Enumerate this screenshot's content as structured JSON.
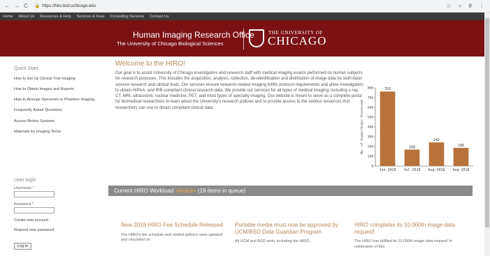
{
  "browser": {
    "back": "←",
    "forward": "→",
    "reload": "C",
    "url": "https://hiro.bsd.uchicago.edu",
    "star": "☆",
    "menu": "⋮",
    "ext": "○",
    "account": "θ"
  },
  "topnav": [
    "Home",
    "About Us",
    "Resources & Help",
    "Services & Fees",
    "Consulting Services",
    "Contact Us"
  ],
  "banner": {
    "title": "Human Imaging Research Office",
    "subtitle": "The University of Chicago Biological Sciences",
    "univ_top": "THE UNIVERSITY OF",
    "univ_bottom": "CHICAGO"
  },
  "sidebar": {
    "heading": "Quick Start",
    "links": [
      "How to Set Up Clinical Trial Imaging",
      "How to Obtain Images and Reports",
      "How to Arrange Specimen or Phantom Imaging",
      "Frequently Asked Questions",
      "Access Broker Systems",
      "Materials for Imaging Techs"
    ]
  },
  "login": {
    "heading": "User login",
    "username_label": "Username *",
    "password_label": "Password *",
    "create": "Create new account",
    "request": "Request new password",
    "button": "Log in"
  },
  "main": {
    "welcome": "Welcome to the HIRO!",
    "intro": "Our goal is to assist University of Chicago investigators and research staff with medical imaging exams performed on human subjects for research purposes. This includes the acquisition, analysis, collection, de-identification and distribution of image data for both basic science research and clinical trials. Our services ensure research-related imaging fulfills protocol requirements and allow investigators to obtain HIPAA- and IRB-compliant clinical research data. We provide our services for all types of medical imaging, including x-ray, CT, MRI, ultrasound, nuclear medicine, PET, and most types of specialty imaging. Our website is meant to serve as a complete portal for biomedical researchers to learn about the University's research policies and to provide access to the various resources that researchers can use to obtain compliant clinical data."
  },
  "workload": {
    "prefix": "Current HIRO Workload:",
    "level": "Medium",
    "suffix": "(19 items in queue)"
  },
  "news": [
    {
      "title": "New 2018 HIRO Fee Schedule Released",
      "body": "The HIRO's fee schedule and related policies were updated and circulated on"
    },
    {
      "title": "Portable media must now be approved by UCM/BSD Data Guardian Program",
      "body": "All UCM and BSD units, including the HIRO,"
    },
    {
      "title": "HIRO completes its 10,000th image data request!",
      "body": "The HIRO has fulfilled its 10,000th image data request! In celebration of this"
    }
  ],
  "chart_data": {
    "type": "bar",
    "categories": [
      "Jun-2018",
      "Jul-2018",
      "Aug-2018",
      "Sep-2018"
    ],
    "values": [
      763,
      168,
      242,
      186
    ],
    "ylabel": "No. of Exams/Scans Processed",
    "ylim": [
      0,
      800
    ],
    "yticks": [
      0,
      100,
      200,
      300,
      400,
      500,
      600,
      700,
      800
    ],
    "bar_color": "#b8733a"
  }
}
